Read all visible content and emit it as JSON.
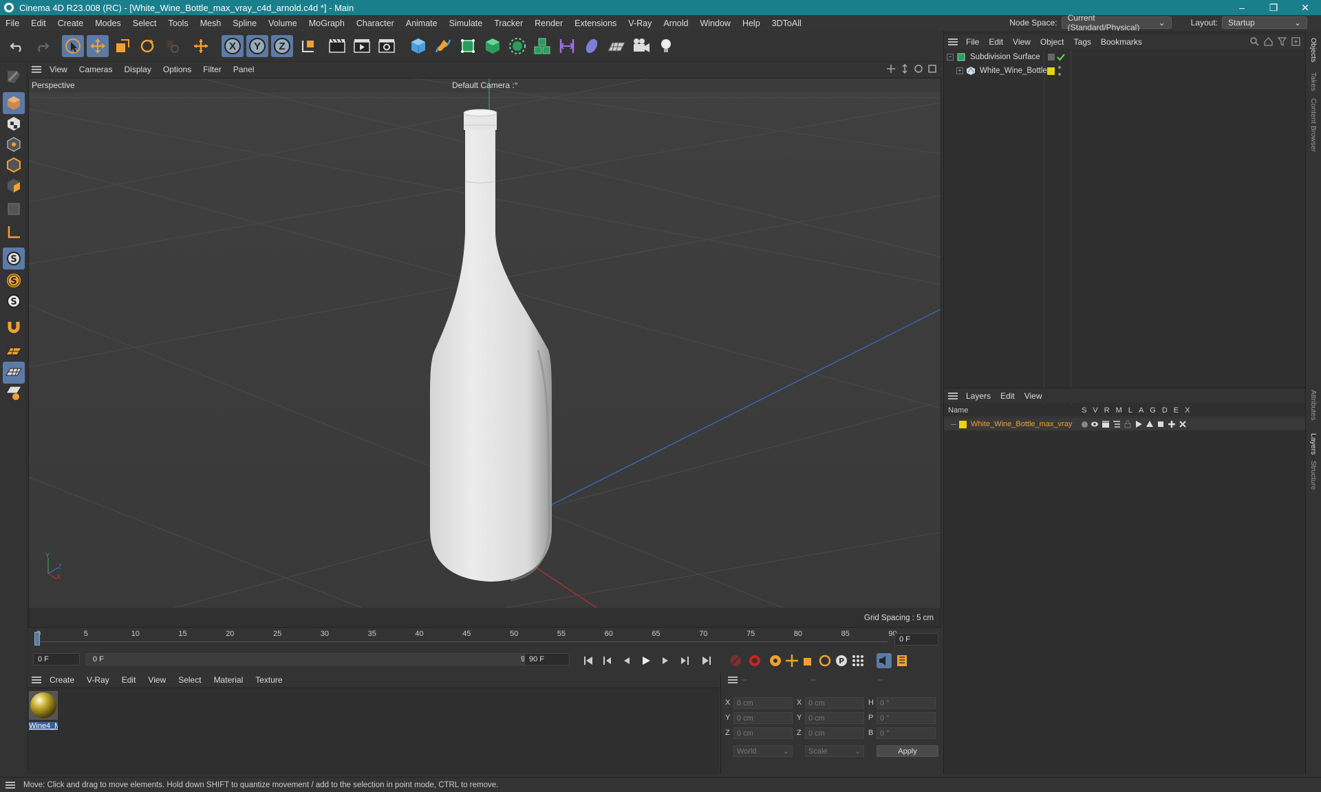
{
  "window": {
    "title": "Cinema 4D R23.008 (RC) - [White_Wine_Bottle_max_vray_c4d_arnold.c4d *] - Main",
    "controls": [
      "–",
      "❐",
      "✕"
    ]
  },
  "menubar": {
    "items": [
      "File",
      "Edit",
      "Create",
      "Modes",
      "Select",
      "Tools",
      "Mesh",
      "Spline",
      "Volume",
      "MoGraph",
      "Character",
      "Animate",
      "Simulate",
      "Tracker",
      "Render",
      "Extensions",
      "V-Ray",
      "Arnold",
      "Window",
      "Help",
      "3DToAll"
    ],
    "node_space_label": "Node Space:",
    "node_space_value": "Current (Standard/Physical)",
    "layout_label": "Layout:",
    "layout_value": "Startup"
  },
  "toolbar": {
    "axis_labels": [
      "X",
      "Y",
      "Z"
    ]
  },
  "viewport": {
    "menu": [
      "View",
      "Cameras",
      "Display",
      "Options",
      "Filter",
      "Panel"
    ],
    "projection": "Perspective",
    "camera": "Default Camera",
    "camera_suffix": ":°",
    "grid_spacing": "Grid Spacing : 5 cm",
    "axis": {
      "y": "Y",
      "z": "Z",
      "x": "X"
    }
  },
  "timeline": {
    "ticks": [
      "0",
      "5",
      "10",
      "15",
      "20",
      "25",
      "30",
      "35",
      "40",
      "45",
      "50",
      "55",
      "60",
      "65",
      "70",
      "75",
      "80",
      "85",
      "90"
    ],
    "current_frame": "0 F",
    "start_field": "0 F",
    "range_start": "0 F",
    "range_end": "90 F",
    "end_field": "90 F"
  },
  "material_panel": {
    "menu": [
      "Create",
      "V-Ray",
      "Edit",
      "View",
      "Select",
      "Material",
      "Texture"
    ],
    "materials": [
      {
        "name": "Wine4_M"
      }
    ]
  },
  "coordinates": {
    "headers": [
      "--",
      "--",
      "--"
    ],
    "rows": [
      {
        "a_label": "X",
        "a_value": "0 cm",
        "b_label": "X",
        "b_value": "0 cm",
        "c_label": "H",
        "c_value": "0 °"
      },
      {
        "a_label": "Y",
        "a_value": "0 cm",
        "b_label": "Y",
        "b_value": "0 cm",
        "c_label": "P",
        "c_value": "0 °"
      },
      {
        "a_label": "Z",
        "a_value": "0 cm",
        "b_label": "Z",
        "b_value": "0 cm",
        "c_label": "B",
        "c_value": "0 °"
      }
    ],
    "space": "World",
    "mode": "Scale",
    "apply": "Apply"
  },
  "objects_panel": {
    "menu": [
      "File",
      "Edit",
      "View",
      "Object",
      "Tags",
      "Bookmarks"
    ],
    "items": [
      {
        "name": "Subdivision Surface",
        "level": 0
      },
      {
        "name": "White_Wine_Bottle",
        "level": 1
      }
    ]
  },
  "layers_panel": {
    "menu": [
      "Layers",
      "Edit",
      "View"
    ],
    "name_header": "Name",
    "columns": [
      "S",
      "V",
      "R",
      "M",
      "L",
      "A",
      "G",
      "D",
      "E",
      "X"
    ],
    "layers": [
      {
        "name": "White_Wine_Bottle_max_vray",
        "color": "#e8d21a"
      }
    ]
  },
  "side_tabs": [
    "Objects",
    "Takes",
    "Content Browser",
    "Attributes",
    "Layers",
    "Structure"
  ],
  "status": "Move: Click and drag to move elements. Hold down SHIFT to quantize movement / add to the selection in point mode, CTRL to remove.",
  "colors": {
    "titlebar": "#1a7f8c",
    "accent_orange": "#f0a030",
    "selected_blue": "#5b7aa6",
    "layer_name": "#f0a030"
  }
}
